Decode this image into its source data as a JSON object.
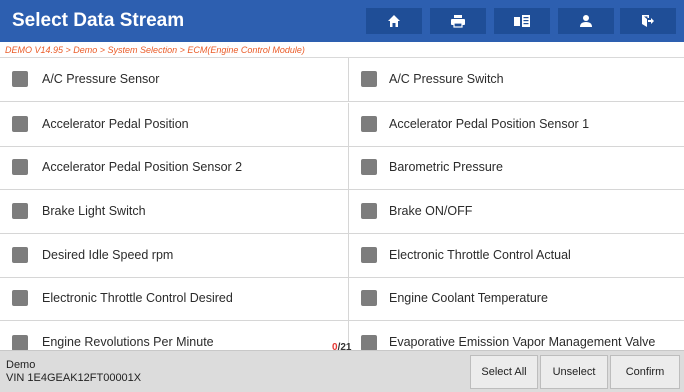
{
  "header": {
    "title": "Select Data Stream",
    "icons": [
      "home-icon",
      "print-icon",
      "report-icon",
      "user-icon",
      "exit-icon"
    ]
  },
  "breadcrumb": "DEMO V14.95 > Demo > System Selection > ECM(Engine Control Module)",
  "items": [
    [
      "A/C Pressure Sensor",
      "A/C Pressure Switch"
    ],
    [
      "Accelerator Pedal Position",
      "Accelerator Pedal Position Sensor 1"
    ],
    [
      "Accelerator Pedal Position Sensor 2",
      "Barometric Pressure"
    ],
    [
      "Brake Light Switch",
      "Brake ON/OFF"
    ],
    [
      "Desired Idle Speed rpm",
      "Electronic Throttle Control Actual"
    ],
    [
      "Electronic Throttle Control Desired",
      "Engine Coolant Temperature"
    ],
    [
      "Engine Revolutions Per Minute",
      "Evaporative Emission Vapor Management Valve"
    ]
  ],
  "counter": {
    "selected": "0",
    "total": "/21"
  },
  "footer": {
    "vehicle": "Demo",
    "vin": "VIN 1E4GEAK12FT00001X",
    "select_all": "Select All",
    "unselect": "Unselect",
    "confirm": "Confirm"
  },
  "colors": {
    "header_bg": "#2d5fb0",
    "breadcrumb_text": "#ea5b27",
    "checkbox": "#7d7d7d",
    "counter_selected": "#e53935"
  }
}
